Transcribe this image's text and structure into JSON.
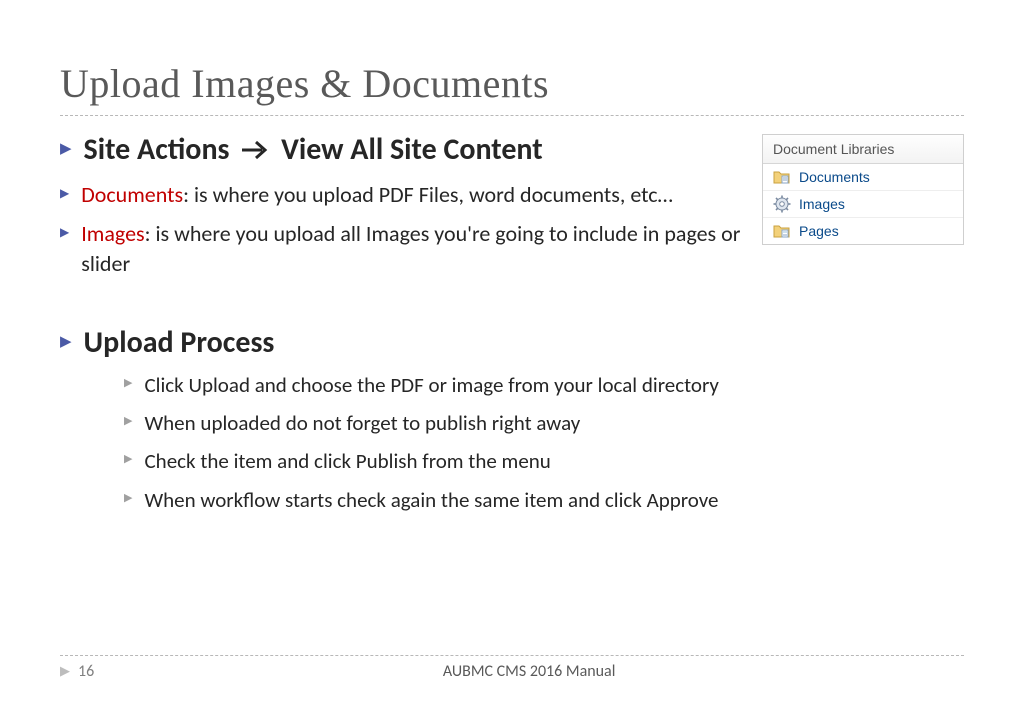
{
  "title": "Upload Images & Documents",
  "nav_line": {
    "prefix": "Site Actions",
    "suffix": "View All Site Content"
  },
  "bullets": {
    "documents": {
      "label": "Documents",
      "text": ": is where you upload PDF Files, word documents, etc…"
    },
    "images": {
      "label": "Images",
      "text": ": is where you upload all Images you're going to include in pages or slider"
    }
  },
  "upload_process_heading": "Upload Process",
  "upload_steps": [
    "Click Upload and choose the PDF or image from your local directory",
    "When uploaded do not forget to publish right away",
    "Check the item and click Publish from the menu",
    "When workflow starts check again the same item and click Approve"
  ],
  "doclib": {
    "header": "Document Libraries",
    "items": [
      "Documents",
      "Images",
      "Pages"
    ]
  },
  "footer": {
    "page": "16",
    "manual": "AUBMC CMS 2016 Manual"
  }
}
